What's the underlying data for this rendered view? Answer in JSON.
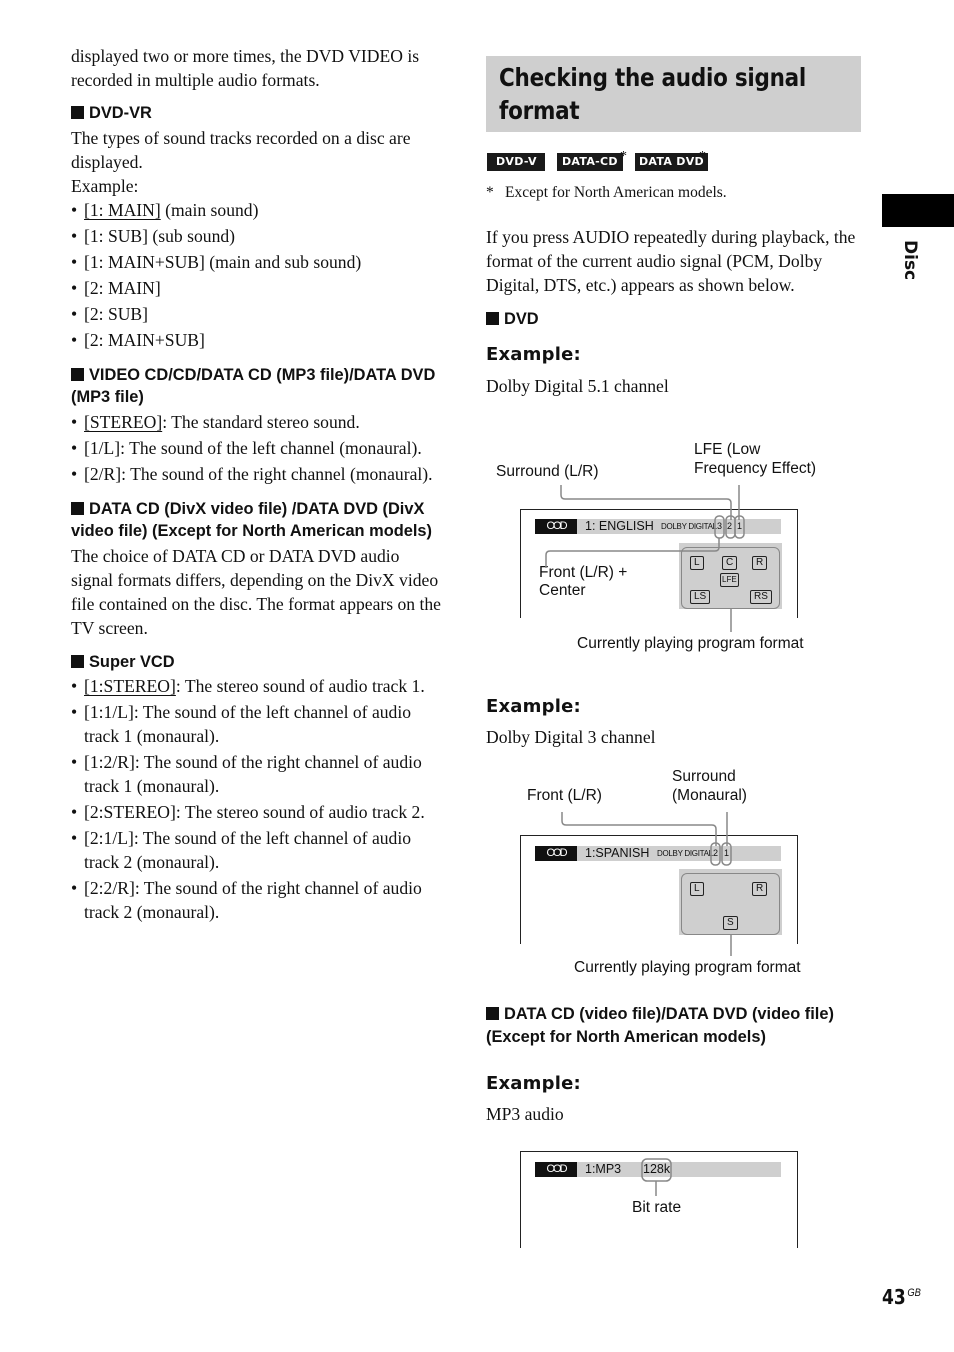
{
  "left": {
    "intro": "displayed two or more times, the DVD VIDEO is recorded in multiple audio formats.",
    "dvdvr": {
      "heading": "DVD-VR",
      "text1": "The types of sound tracks recorded on a disc are displayed.",
      "text2": "Example:",
      "items": [
        {
          "code": "[1: MAIN]",
          "desc": " (main sound)",
          "underlined": true
        },
        {
          "code": "[1: SUB]",
          "desc": " (sub sound)"
        },
        {
          "code": "[1: MAIN+SUB]",
          "desc": " (main and sub sound)"
        },
        {
          "code": "[2: MAIN]",
          "desc": ""
        },
        {
          "code": "[2: SUB]",
          "desc": ""
        },
        {
          "code": "[2: MAIN+SUB]",
          "desc": ""
        }
      ]
    },
    "videocd": {
      "heading": "VIDEO CD/CD/DATA CD (MP3 file)/DATA DVD (MP3 file)",
      "items": [
        {
          "code": "[STEREO]",
          "desc": ": The standard stereo sound.",
          "underlined": true
        },
        {
          "code": "[1/L]",
          "desc": ": The sound of the left channel (monaural)."
        },
        {
          "code": "[2/R]",
          "desc": ": The sound of the right channel (monaural)."
        }
      ]
    },
    "divx": {
      "heading": "DATA CD (DivX video file) /DATA DVD (DivX video file) (Except for North American models)",
      "text": "The choice of DATA CD or DATA DVD audio signal formats differs, depending on the DivX video file contained on the disc. The format appears on the TV screen."
    },
    "svcd": {
      "heading": "Super VCD",
      "items": [
        {
          "code": "[1:STEREO]",
          "desc": ": The stereo sound of audio track 1.",
          "underlined": true
        },
        {
          "code": "[1:1/L]",
          "desc": ": The sound of the left channel of audio track 1 (monaural)."
        },
        {
          "code": "[1:2/R]",
          "desc": ": The sound of the right channel of audio track 1 (monaural)."
        },
        {
          "code": "[2:STEREO]",
          "desc": ": The stereo sound of audio track 2."
        },
        {
          "code": "[2:1/L]",
          "desc": ": The sound of the left channel of audio track 2 (monaural)."
        },
        {
          "code": "[2:2/R]",
          "desc": ": The sound of the right channel of audio track 2 (monaural)."
        }
      ]
    }
  },
  "right": {
    "title": "Checking the audio signal format",
    "title_line1": "Checking the audio signal",
    "title_line2": "format",
    "badges": [
      "DVD-V",
      "DATA-CD",
      "DATA DVD"
    ],
    "badge_star": "*",
    "footnote_mark": "*",
    "footnote": "Except for North American models.",
    "intro": "If you press AUDIO repeatedly during playback, the format of the current audio signal (PCM, Dolby Digital, DTS, etc.) appears as shown below.",
    "dvd_heading": "DVD",
    "example_label": "Example:",
    "ex1": {
      "caption": "Dolby Digital 5.1 channel",
      "callout_surround": "Surround (L/R)",
      "callout_lfe_1": "LFE (Low",
      "callout_lfe_2": "Frequency Effect)",
      "callout_front_1": "Front (L/R) +",
      "callout_front_2": "Center",
      "callout_program": "Currently playing program format",
      "icon": "audio-icon",
      "icon_glyph": "OOD",
      "lang": "1: ENGLISH",
      "format": "DOLBY DIGITAL",
      "channels": [
        "3",
        "2",
        "1"
      ],
      "speakers": [
        "L",
        "C",
        "R",
        "LFE",
        "LS",
        "RS"
      ]
    },
    "ex2": {
      "caption": "Dolby Digital 3 channel",
      "callout_front": "Front (L/R)",
      "callout_surround_1": "Surround",
      "callout_surround_2": "(Monaural)",
      "callout_program": "Currently playing program format",
      "icon_glyph": "OOD",
      "lang": "1:SPANISH",
      "format": "DOLBY DIGITAL",
      "channels": [
        "2",
        "1"
      ],
      "speakers": [
        "L",
        "R",
        "S"
      ]
    },
    "datacd_heading": "DATA CD (video file)/DATA DVD (video file) (Except for North American models)",
    "ex3": {
      "caption": "MP3 audio",
      "icon_glyph": "OOD",
      "lang": "1:MP3",
      "bitrate": "128k",
      "callout_bitrate": "Bit rate"
    }
  },
  "side_tab": "Disc",
  "page": {
    "number": "43",
    "suffix": "GB"
  }
}
